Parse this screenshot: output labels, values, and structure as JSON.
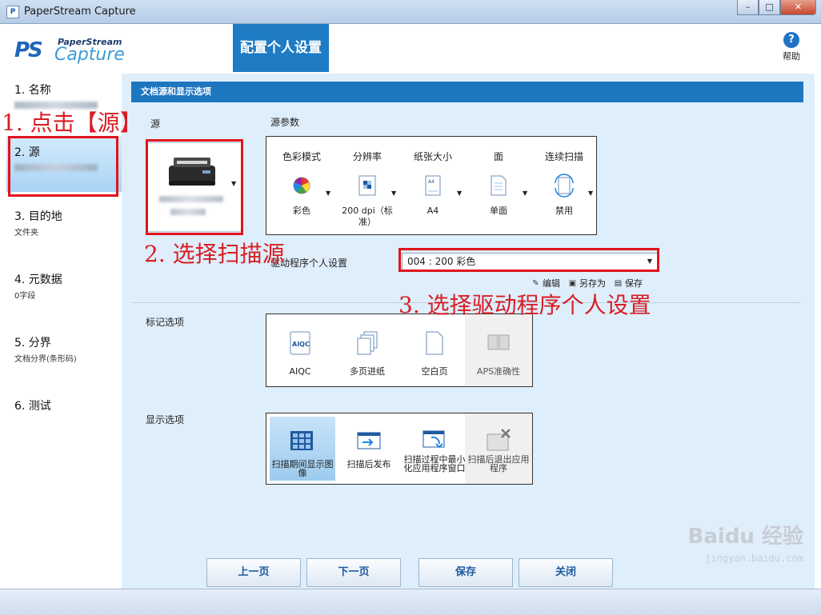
{
  "window": {
    "title": "PaperStream Capture",
    "controls": {
      "minimize": "–",
      "maximize": "□",
      "close": "✕"
    }
  },
  "header": {
    "logo": {
      "mark": "PS",
      "top": "PaperStream",
      "bottom": "Capture"
    },
    "banner": "配置个人设置",
    "help_label": "帮助"
  },
  "sidebar": {
    "items": [
      {
        "label": "1. 名称",
        "sub": ""
      },
      {
        "label": "2. 源",
        "sub": ""
      },
      {
        "label": "3. 目的地",
        "sub": "文件夹"
      },
      {
        "label": "4. 元数据",
        "sub": "0字段"
      },
      {
        "label": "5. 分界",
        "sub": "文档分界(条形码)"
      },
      {
        "label": "6. 测试",
        "sub": ""
      }
    ]
  },
  "main": {
    "section_title": "文档源和显示选项",
    "source_label": "源",
    "source_params_label": "源参数",
    "params": [
      {
        "heading": "色彩模式",
        "value": "彩色",
        "icon": "color-wheel-icon"
      },
      {
        "heading": "分辨率",
        "value": "200 dpi（标准）",
        "icon": "resolution-icon"
      },
      {
        "heading": "纸张大小",
        "value": "A4",
        "icon": "paper-size-icon"
      },
      {
        "heading": "面",
        "value": "单面",
        "icon": "single-side-icon"
      },
      {
        "heading": "连续扫描",
        "value": "禁用",
        "icon": "continuous-scan-icon"
      }
    ],
    "profile_label": "驱动程序个人设置",
    "profile_value": "004 : 200 彩色",
    "actions": {
      "edit": "编辑",
      "save_as": "另存为",
      "save": "保存"
    },
    "mark_options_label": "标记选项",
    "mark_options": [
      "AIQC",
      "多页进纸",
      "空白页",
      "APS准确性"
    ],
    "display_options_label": "显示选项",
    "display_options": [
      "扫描期间显示图像",
      "扫描后发布",
      "扫描过程中最小化应用程序窗口",
      "扫描后退出应用程序"
    ]
  },
  "buttons": {
    "prev": "上一页",
    "next": "下一页",
    "save": "保存",
    "close": "关闭"
  },
  "annotations": {
    "step1": "1. 点击【源】",
    "step2": "2. 选择扫描源",
    "step3": "3. 选择驱动程序个人设置"
  },
  "watermark": {
    "main": "Baidu 经验",
    "url": "jingyan.baidu.com"
  }
}
